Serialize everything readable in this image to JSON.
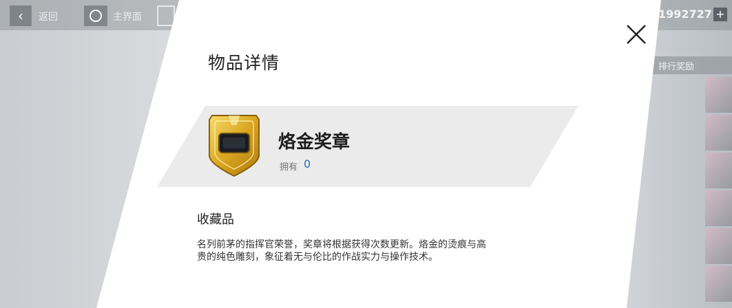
{
  "header": {
    "back_label": "返回",
    "home_label": "主界面",
    "currency_value": "1992727"
  },
  "side": {
    "reward_tab_label": "排行奖励"
  },
  "modal": {
    "title": "物品详情",
    "item_name": "烙金奖章",
    "owned_label": "拥有",
    "owned_value": "0",
    "category": "收藏品",
    "description": "名列前茅的指挥官荣誉，奖章将根据获得次数更新。烙金的烫痕与高贵的纯色雕刻，象征着无与伦比的作战实力与操作技术。"
  },
  "icons": {
    "close": "close-icon",
    "medal": "gold-medal-icon"
  },
  "colors": {
    "owned_value": "#2f6fb6",
    "medal_gold": "#d9a520"
  }
}
